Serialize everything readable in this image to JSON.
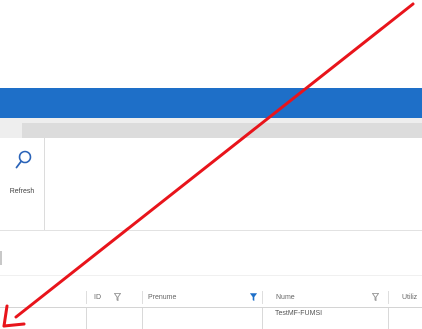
{
  "colors": {
    "accent_bar": "#1e6fc8",
    "annotation_arrow": "#e8141b",
    "filter_active": "#1e6fc8",
    "filter_inactive": "#8a8a8a"
  },
  "ribbon": {
    "refresh_label": "Refresh",
    "refresh_icon": "search-icon"
  },
  "grid": {
    "columns": [
      {
        "label": "ID",
        "filter_active": false
      },
      {
        "label": "Prenume",
        "filter_active": true
      },
      {
        "label": "Nume",
        "filter_active": true
      },
      {
        "label": "Utiliz",
        "filter_active": false
      }
    ],
    "rows": [
      {
        "id": "",
        "prenume": "",
        "nume": "TestMF-FUMSI",
        "utiliz": ""
      }
    ]
  },
  "annotation": {
    "type": "arrow",
    "color": "#e8141b",
    "direction": "top-right to bottom-left"
  }
}
